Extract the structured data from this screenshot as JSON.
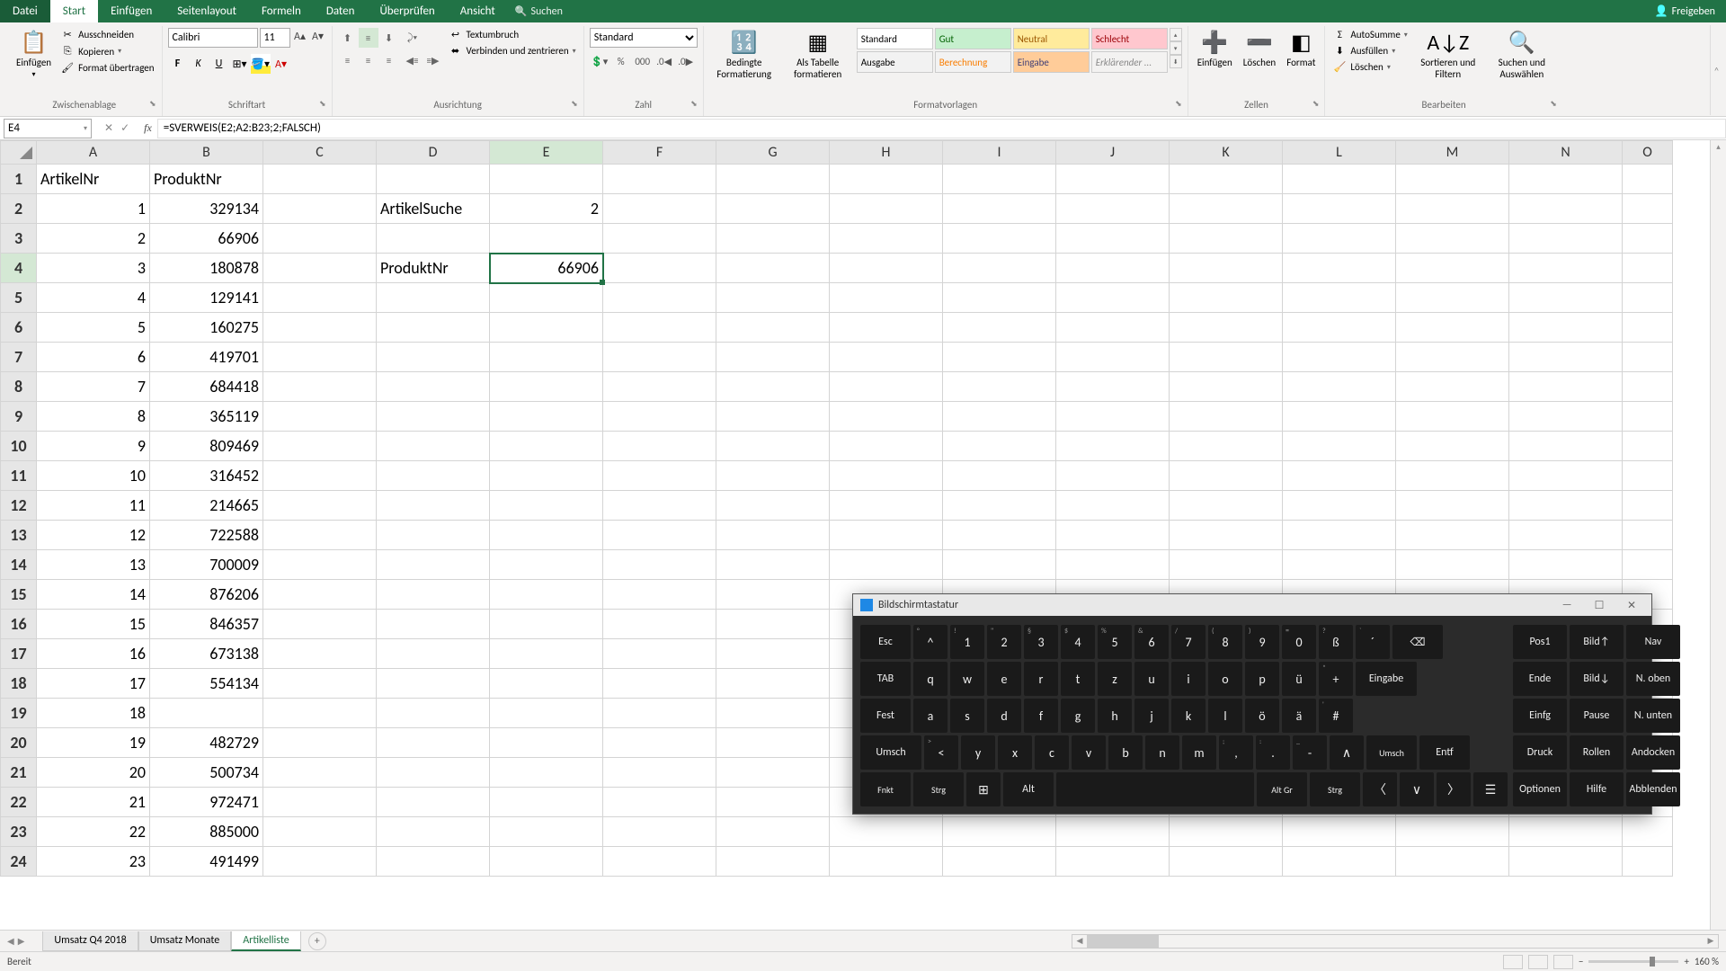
{
  "titlebar": {
    "menu": [
      "Datei",
      "Start",
      "Einfügen",
      "Seitenlayout",
      "Formeln",
      "Daten",
      "Überprüfen",
      "Ansicht"
    ],
    "active_index": 1,
    "search": "Suchen",
    "share": "Freigeben"
  },
  "ribbon": {
    "paste": "Einfügen",
    "cut": "Ausschneiden",
    "copy": "Kopieren",
    "format_painter": "Format übertragen",
    "clipboard": "Zwischenablage",
    "font_name": "Calibri",
    "font_size": "11",
    "font": "Schriftart",
    "wrap": "Textumbruch",
    "merge": "Verbinden und zentrieren",
    "alignment": "Ausrichtung",
    "number_format": "Standard",
    "number": "Zahl",
    "cond_format": "Bedingte Formatierung",
    "as_table": "Als Tabelle formatieren",
    "styles": {
      "standard": "Standard",
      "gut": "Gut",
      "neutral": "Neutral",
      "schlecht": "Schlecht",
      "ausgabe": "Ausgabe",
      "berechnung": "Berechnung",
      "eingabe": "Eingabe",
      "erkl": "Erklärender ..."
    },
    "styles_label": "Formatvorlagen",
    "insert": "Einfügen",
    "delete": "Löschen",
    "format": "Format",
    "cells": "Zellen",
    "autosum": "AutoSumme",
    "fill": "Ausfüllen",
    "clear": "Löschen",
    "sort": "Sortieren und Filtern",
    "find": "Suchen und Auswählen",
    "editing": "Bearbeiten"
  },
  "formula_bar": {
    "cell_ref": "E4",
    "formula": "=SVERWEIS(E2;A2:B23;2;FALSCH)"
  },
  "grid": {
    "columns": [
      "A",
      "B",
      "C",
      "D",
      "E",
      "F",
      "G",
      "H",
      "I",
      "J",
      "K",
      "L",
      "M",
      "N",
      "O"
    ],
    "selected_col": "E",
    "selected_row": 4,
    "headers": {
      "A1": "ArtikelNr",
      "B1": "ProduktNr"
    },
    "labels": {
      "D2": "ArtikelSuche",
      "D4": "ProduktNr"
    },
    "lookup": {
      "E2": "2",
      "E4": "66906"
    },
    "data": {
      "A": [
        "1",
        "2",
        "3",
        "4",
        "5",
        "6",
        "7",
        "8",
        "9",
        "10",
        "11",
        "12",
        "13",
        "14",
        "15",
        "16",
        "17",
        "18",
        "19",
        "20",
        "21",
        "22",
        "23"
      ],
      "B": [
        "329134",
        "66906",
        "180878",
        "129141",
        "160275",
        "419701",
        "684418",
        "365119",
        "809469",
        "316452",
        "214665",
        "722588",
        "700009",
        "876206",
        "846357",
        "673138",
        "554134",
        "",
        "482729",
        "500734",
        "972471",
        "885000",
        "491499"
      ]
    }
  },
  "tabs": {
    "items": [
      "Umsatz Q4 2018",
      "Umsatz Monate",
      "Artikelliste"
    ],
    "active": 2
  },
  "status": {
    "ready": "Bereit",
    "zoom": "160 %"
  },
  "osk": {
    "title": "Bildschirmtastatur",
    "rows": [
      [
        {
          "l": "Esc",
          "w": "wide"
        },
        {
          "l": "^",
          "s": "°"
        },
        {
          "l": "1",
          "s": "!"
        },
        {
          "l": "2",
          "s": "\""
        },
        {
          "l": "3",
          "s": "§"
        },
        {
          "l": "4",
          "s": "$"
        },
        {
          "l": "5",
          "s": "%"
        },
        {
          "l": "6",
          "s": "&"
        },
        {
          "l": "7",
          "s": "/"
        },
        {
          "l": "8",
          "s": "("
        },
        {
          "l": "9",
          "s": ")"
        },
        {
          "l": "0",
          "s": "="
        },
        {
          "l": "ß",
          "s": "?"
        },
        {
          "l": "´",
          "s": "`"
        },
        {
          "l": "⌫",
          "w": "wide"
        }
      ],
      [
        {
          "l": "TAB",
          "w": "wide"
        },
        {
          "l": "q"
        },
        {
          "l": "w"
        },
        {
          "l": "e"
        },
        {
          "l": "r"
        },
        {
          "l": "t"
        },
        {
          "l": "z"
        },
        {
          "l": "u"
        },
        {
          "l": "i"
        },
        {
          "l": "o"
        },
        {
          "l": "p"
        },
        {
          "l": "ü"
        },
        {
          "l": "+",
          "s": "*"
        },
        {
          "l": "Eingabe",
          "w": "wider"
        }
      ],
      [
        {
          "l": "Fest",
          "w": "wide"
        },
        {
          "l": "a"
        },
        {
          "l": "s"
        },
        {
          "l": "d"
        },
        {
          "l": "f"
        },
        {
          "l": "g"
        },
        {
          "l": "h"
        },
        {
          "l": "j"
        },
        {
          "l": "k"
        },
        {
          "l": "l"
        },
        {
          "l": "ö"
        },
        {
          "l": "ä"
        },
        {
          "l": "#",
          "s": "'"
        }
      ],
      [
        {
          "l": "Umsch",
          "w": "wider"
        },
        {
          "l": "<",
          "s": ">"
        },
        {
          "l": "y"
        },
        {
          "l": "x"
        },
        {
          "l": "c"
        },
        {
          "l": "v"
        },
        {
          "l": "b"
        },
        {
          "l": "n"
        },
        {
          "l": "m"
        },
        {
          "l": ",",
          "s": ";"
        },
        {
          "l": ".",
          "s": ":"
        },
        {
          "l": "-",
          "s": "_"
        },
        {
          "l": "∧"
        },
        {
          "l": "Umsch",
          "w": "wide small"
        },
        {
          "l": "Entf",
          "w": "wide"
        }
      ],
      [
        {
          "l": "Fnkt",
          "w": "wide small"
        },
        {
          "l": "Strg",
          "w": "wide small"
        },
        {
          "l": "⊞"
        },
        {
          "l": "Alt",
          "w": "wide"
        },
        {
          "l": "",
          "w": "space"
        },
        {
          "l": "Alt Gr",
          "w": "wide small"
        },
        {
          "l": "Strg",
          "w": "wide small"
        },
        {
          "l": "〈"
        },
        {
          "l": "∨"
        },
        {
          "l": "〉"
        },
        {
          "l": "☰"
        }
      ]
    ],
    "side": [
      "Pos1",
      "Bild↑",
      "Nav",
      "Ende",
      "Bild↓",
      "N. oben",
      "Einfg",
      "Pause",
      "N. unten",
      "Druck",
      "Rollen",
      "Andocken",
      "Optionen",
      "Hilfe",
      "Abblenden"
    ]
  }
}
